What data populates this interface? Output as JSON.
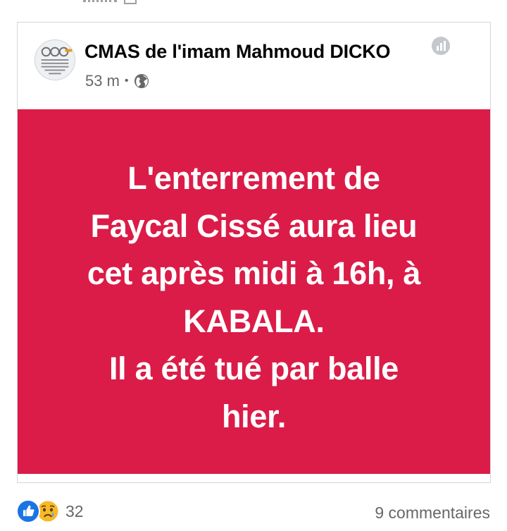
{
  "post": {
    "page_name": "CMAS de l'imam Mahmoud DICKO",
    "time": "53 m",
    "separator": "•",
    "image_text_lines": [
      "L'enterrement de",
      "Faycal Cissé aura lieu",
      "cet après midi à 16h, à",
      "KABALA.",
      "Il a été tué par balle",
      "hier."
    ],
    "image_bg_color": "#db1c48"
  },
  "footer": {
    "reaction_count": "32",
    "comments_label": "9 commentaires"
  },
  "icons": {
    "avatar": "page-logo-avatar",
    "insights": "insights-icon",
    "audience": "globe-icon",
    "like": "like-icon",
    "sad": "sad-icon"
  }
}
